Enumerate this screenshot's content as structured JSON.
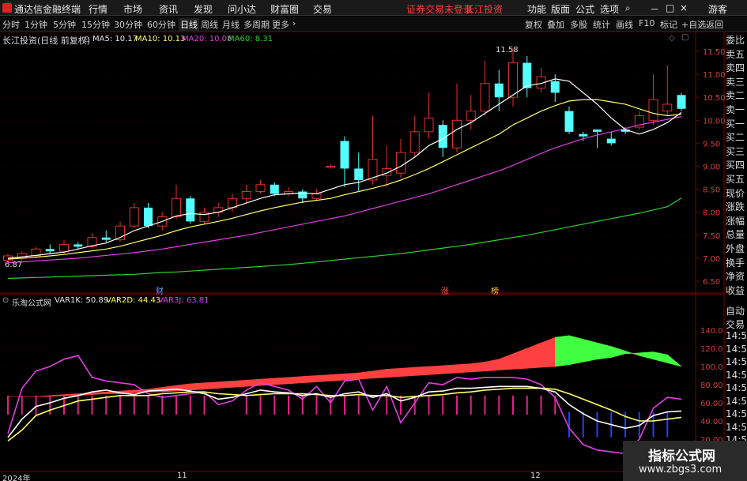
{
  "menubar": {
    "app_title": "通达信金融终端",
    "items": [
      "行情",
      "市场",
      "资讯",
      "发现",
      "问小达",
      "财富圈",
      "交易"
    ],
    "login_notice": "证券交易未登录",
    "stock_name": "长江投资",
    "right_items": [
      "功能",
      "版面",
      "公式",
      "选项"
    ],
    "guest": "游客"
  },
  "toolbar": {
    "periods": [
      "分时",
      "1分钟",
      "5分钟",
      "15分钟",
      "30分钟",
      "60分钟",
      "日线",
      "周线",
      "月线",
      "多周期",
      "更多"
    ],
    "active_period": "日线",
    "right_buttons": [
      "复权",
      "叠加",
      "多股",
      "统计",
      "画线",
      "F10",
      "标记",
      "+自选",
      "返回"
    ]
  },
  "main_header": {
    "title": "长江投资(日线 前复权)",
    "ma5": "MA5: 10.17",
    "ma10": "MA10: 10.13",
    "ma20": "MA20: 10.08",
    "ma60": "MA60: 8.31"
  },
  "annotations": {
    "high": "11.58",
    "low": "6.87",
    "cai": "财",
    "zhang": "涨",
    "bang": "榜"
  },
  "sub_header": {
    "title": "乐淘公式网",
    "var1": "VAR1K: 50.89",
    "var2": "VAR2D: 44.43",
    "var3": "VAR3J: 63.81"
  },
  "price_axis": [
    "11.50",
    "11.00",
    "10.50",
    "10.00",
    "9.50",
    "9.00",
    "8.50",
    "8.00",
    "7.50",
    "7.00",
    "6.50"
  ],
  "sub_axis": [
    "140.0",
    "120.0",
    "100.0",
    "80.00",
    "60.00",
    "40.00",
    "20.00"
  ],
  "date_labels": [
    "2024年",
    "11",
    "12"
  ],
  "side_panel": [
    "委比",
    "卖五",
    "卖四",
    "卖三",
    "卖二",
    "卖一",
    "买一",
    "买二",
    "买三",
    "买四",
    "买五",
    "现价",
    "涨跌",
    "涨幅",
    "总量",
    "外盘",
    "换手",
    "净资",
    "收益"
  ],
  "side_panel2": [
    "自动",
    "交易",
    "14:56",
    "14:56",
    "14:56",
    "14:56",
    "14:56",
    "14:56",
    "14:56",
    "14:56",
    "14:56",
    "14:56",
    "14:56"
  ],
  "watermark": {
    "title": "指标公式网",
    "url": "www.zbgs3.com"
  },
  "colors": {
    "up": "#e03030",
    "down": "#54ffff",
    "ma5": "#ffffff",
    "ma10": "#ffff66",
    "ma20": "#e040e0",
    "ma60": "#30d030",
    "band_up": "#ff4040",
    "band_down": "#40ff40"
  },
  "chart_data": {
    "type": "candlestick",
    "price_range": [
      6.35,
      11.75
    ],
    "candles": [
      [
        6.95,
        7.05,
        6.9,
        7.1
      ],
      [
        7.0,
        7.1,
        6.95,
        7.15
      ],
      [
        7.05,
        7.2,
        7.0,
        7.25
      ],
      [
        7.2,
        7.15,
        7.1,
        7.3
      ],
      [
        7.15,
        7.3,
        7.1,
        7.4
      ],
      [
        7.3,
        7.25,
        7.2,
        7.35
      ],
      [
        7.25,
        7.45,
        7.2,
        7.55
      ],
      [
        7.45,
        7.4,
        7.35,
        7.6
      ],
      [
        7.4,
        7.7,
        7.35,
        7.8
      ],
      [
        7.7,
        8.1,
        7.65,
        8.2
      ],
      [
        8.1,
        7.7,
        7.65,
        8.2
      ],
      [
        7.7,
        7.9,
        7.6,
        8.0
      ],
      [
        7.9,
        8.3,
        7.85,
        8.6
      ],
      [
        8.3,
        7.8,
        7.75,
        8.35
      ],
      [
        7.8,
        8.0,
        7.75,
        8.1
      ],
      [
        8.0,
        8.1,
        7.9,
        8.2
      ],
      [
        8.1,
        8.3,
        8.0,
        8.4
      ],
      [
        8.3,
        8.45,
        8.2,
        8.6
      ],
      [
        8.45,
        8.6,
        8.4,
        8.7
      ],
      [
        8.6,
        8.4,
        8.35,
        8.65
      ],
      [
        8.4,
        8.45,
        8.35,
        8.55
      ],
      [
        8.45,
        8.3,
        8.2,
        8.5
      ],
      [
        8.3,
        8.4,
        8.25,
        8.5
      ],
      [
        9.0,
        9.0,
        8.95,
        9.05
      ],
      [
        9.55,
        8.95,
        8.55,
        9.65
      ],
      [
        8.95,
        8.7,
        8.45,
        9.3
      ],
      [
        8.7,
        9.15,
        8.6,
        10.1
      ],
      [
        8.8,
        8.95,
        8.55,
        9.45
      ],
      [
        8.85,
        9.3,
        8.75,
        9.6
      ],
      [
        9.3,
        9.75,
        9.2,
        10.1
      ],
      [
        9.75,
        10.05,
        9.6,
        10.6
      ],
      [
        9.9,
        9.4,
        9.2,
        10.0
      ],
      [
        9.4,
        10.0,
        9.3,
        10.8
      ],
      [
        10.0,
        10.2,
        9.8,
        10.55
      ],
      [
        10.2,
        10.8,
        10.1,
        11.3
      ],
      [
        10.8,
        10.5,
        10.2,
        11.1
      ],
      [
        10.5,
        11.25,
        10.3,
        11.58
      ],
      [
        11.25,
        10.7,
        10.5,
        11.4
      ],
      [
        10.7,
        10.95,
        10.6,
        11.15
      ],
      [
        10.85,
        10.6,
        10.4,
        11.0
      ],
      [
        10.2,
        9.75,
        9.7,
        10.3
      ],
      [
        9.7,
        9.65,
        9.55,
        9.75
      ],
      [
        9.8,
        9.75,
        9.4,
        9.8
      ],
      [
        9.6,
        9.5,
        9.45,
        9.75
      ],
      [
        9.8,
        9.75,
        9.7,
        9.85
      ],
      [
        9.85,
        10.1,
        9.8,
        10.2
      ],
      [
        10.0,
        10.45,
        9.9,
        11.0
      ],
      [
        10.2,
        10.35,
        10.1,
        11.2
      ],
      [
        10.55,
        10.25,
        10.2,
        10.6
      ]
    ],
    "ma5": [
      7.0,
      7.03,
      7.06,
      7.1,
      7.13,
      7.2,
      7.27,
      7.33,
      7.45,
      7.6,
      7.7,
      7.8,
      7.92,
      7.97,
      7.95,
      8.0,
      8.1,
      8.2,
      8.3,
      8.38,
      8.4,
      8.42,
      8.4,
      8.5,
      8.6,
      8.65,
      8.75,
      8.85,
      9.0,
      9.2,
      9.45,
      9.6,
      9.8,
      9.95,
      10.15,
      10.35,
      10.55,
      10.75,
      10.8,
      10.9,
      10.85,
      10.6,
      10.35,
      10.05,
      9.8,
      9.7,
      9.8,
      9.95,
      10.17
    ],
    "ma10": [
      6.98,
      7.0,
      7.02,
      7.05,
      7.08,
      7.12,
      7.16,
      7.2,
      7.26,
      7.34,
      7.42,
      7.5,
      7.6,
      7.68,
      7.74,
      7.8,
      7.87,
      7.95,
      8.03,
      8.1,
      8.16,
      8.22,
      8.26,
      8.3,
      8.38,
      8.45,
      8.52,
      8.6,
      8.7,
      8.82,
      8.95,
      9.1,
      9.25,
      9.4,
      9.55,
      9.7,
      9.9,
      10.05,
      10.2,
      10.32,
      10.42,
      10.45,
      10.45,
      10.4,
      10.35,
      10.25,
      10.15,
      10.1,
      10.13
    ],
    "ma20": [
      6.9,
      6.92,
      6.94,
      6.96,
      6.98,
      7.0,
      7.03,
      7.06,
      7.09,
      7.12,
      7.16,
      7.2,
      7.25,
      7.3,
      7.35,
      7.4,
      7.45,
      7.5,
      7.56,
      7.62,
      7.68,
      7.74,
      7.8,
      7.86,
      7.92,
      8.0,
      8.08,
      8.16,
      8.24,
      8.32,
      8.4,
      8.5,
      8.6,
      8.7,
      8.8,
      8.9,
      9.02,
      9.15,
      9.28,
      9.4,
      9.5,
      9.6,
      9.68,
      9.75,
      9.82,
      9.9,
      9.96,
      10.02,
      10.08
    ],
    "ma60": [
      6.56,
      6.57,
      6.58,
      6.59,
      6.6,
      6.61,
      6.62,
      6.63,
      6.64,
      6.65,
      6.67,
      6.69,
      6.7,
      6.72,
      6.74,
      6.76,
      6.78,
      6.8,
      6.82,
      6.84,
      6.86,
      6.89,
      6.92,
      6.95,
      6.98,
      7.01,
      7.04,
      7.07,
      7.1,
      7.14,
      7.18,
      7.22,
      7.26,
      7.3,
      7.35,
      7.4,
      7.45,
      7.5,
      7.56,
      7.62,
      7.68,
      7.74,
      7.8,
      7.86,
      7.92,
      7.98,
      8.05,
      8.12,
      8.31
    ],
    "sub_range": [
      14,
      150
    ],
    "band_top": [
      67,
      67,
      67,
      68,
      69,
      70,
      71,
      72,
      73,
      74,
      75,
      77,
      79,
      81,
      82,
      83,
      84,
      85,
      86,
      87,
      88,
      89,
      90,
      91,
      92,
      93,
      95,
      97,
      98,
      99,
      100,
      101,
      102,
      103,
      105,
      108,
      114,
      120,
      126,
      132,
      134,
      130,
      126,
      122,
      117,
      112,
      108,
      104,
      100
    ],
    "band_bottom": [
      67,
      67,
      67,
      67,
      68,
      68,
      69,
      70,
      70,
      71,
      72,
      72,
      73,
      74,
      75,
      76,
      77,
      78,
      79,
      80,
      81,
      82,
      83,
      84,
      85,
      86,
      87,
      88,
      89,
      90,
      91,
      92,
      93,
      94,
      95,
      96,
      97,
      98,
      99,
      100,
      102,
      105,
      108,
      110,
      114,
      115,
      116,
      113,
      100
    ],
    "var1k": [
      22,
      42,
      56,
      60,
      65,
      68,
      72,
      74,
      71,
      69,
      73,
      74,
      75,
      73,
      70,
      64,
      66,
      70,
      74,
      72,
      71,
      68,
      70,
      66,
      70,
      72,
      66,
      70,
      62,
      66,
      72,
      73,
      76,
      76,
      77,
      78,
      78,
      78,
      76,
      72,
      58,
      48,
      40,
      36,
      32,
      35,
      46,
      50,
      51
    ],
    "var2d": [
      18,
      30,
      46,
      52,
      57,
      62,
      64,
      66,
      68,
      68,
      68,
      70,
      71,
      72,
      72,
      70,
      69,
      68,
      69,
      70,
      70,
      70,
      69,
      68,
      68,
      69,
      68,
      68,
      66,
      67,
      68,
      69,
      71,
      72,
      74,
      75,
      76,
      76,
      76,
      75,
      70,
      64,
      58,
      52,
      45,
      40,
      40,
      42,
      44
    ],
    "var3j": [
      26,
      76,
      95,
      100,
      108,
      112,
      88,
      84,
      82,
      80,
      70,
      66,
      68,
      70,
      72,
      58,
      62,
      74,
      82,
      78,
      74,
      64,
      78,
      60,
      84,
      86,
      52,
      78,
      38,
      60,
      82,
      80,
      88,
      86,
      88,
      88,
      88,
      86,
      80,
      66,
      32,
      14,
      8,
      6,
      4,
      20,
      54,
      66,
      64
    ],
    "pink_spikes": [
      1,
      1,
      1,
      1,
      1,
      1,
      1,
      1,
      1,
      1,
      1,
      1,
      1,
      1,
      1,
      0,
      0,
      1,
      1,
      1,
      1,
      1,
      1,
      1,
      1,
      1,
      0,
      1,
      1,
      1,
      1,
      1,
      1,
      1,
      1,
      1,
      1,
      1,
      1,
      1,
      0,
      0,
      0,
      0,
      0,
      0,
      0,
      0,
      0
    ],
    "blue_spikes": [
      0,
      0,
      0,
      0,
      0,
      0,
      0,
      0,
      0,
      0,
      0,
      0,
      0,
      0,
      0,
      0,
      0,
      0,
      0,
      0,
      0,
      0,
      0,
      0,
      0,
      0,
      0,
      0,
      0,
      0,
      0,
      0,
      0,
      0,
      0,
      0,
      0,
      0,
      0,
      0,
      1,
      1,
      1,
      1,
      1,
      1,
      1,
      1,
      0
    ]
  }
}
